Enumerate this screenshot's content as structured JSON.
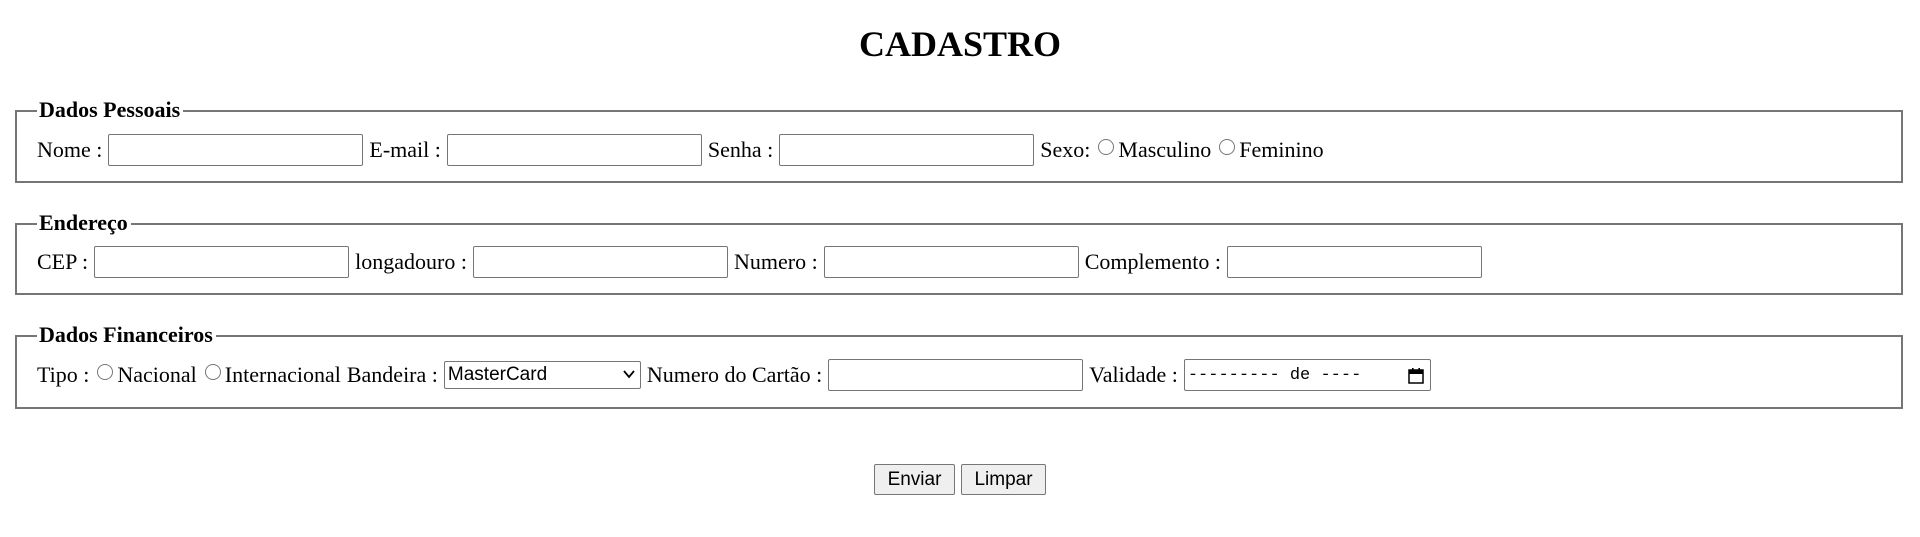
{
  "page": {
    "title": "CADASTRO"
  },
  "dados_pessoais": {
    "legend": "Dados Pessoais",
    "nome_label": "Nome :",
    "nome_value": "",
    "email_label": "E-mail :",
    "email_value": "",
    "senha_label": "Senha :",
    "senha_value": "",
    "sexo_label": "Sexo:",
    "sexo_options": [
      "Masculino",
      "Feminino"
    ]
  },
  "endereco": {
    "legend": "Endereço",
    "cep_label": "CEP :",
    "cep_value": "",
    "logradouro_label": "longadouro :",
    "logradouro_value": "",
    "numero_label": "Numero :",
    "numero_value": "",
    "complemento_label": "Complemento :",
    "complemento_value": ""
  },
  "dados_financeiros": {
    "legend": "Dados Financeiros",
    "tipo_label": "Tipo :",
    "tipo_options": [
      "Nacional",
      "Internacional"
    ],
    "bandeira_label": "Bandeira :",
    "bandeira_selected": "MasterCard",
    "numero_cartao_label": "Numero do Cartão :",
    "numero_cartao_value": "",
    "validade_label": "Validade :",
    "validade_value": "--------- de ----"
  },
  "actions": {
    "submit_label": "Enviar",
    "reset_label": "Limpar"
  },
  "icons": {
    "select_chevron": "chevron-down-icon",
    "date_picker": "calendar-icon"
  }
}
